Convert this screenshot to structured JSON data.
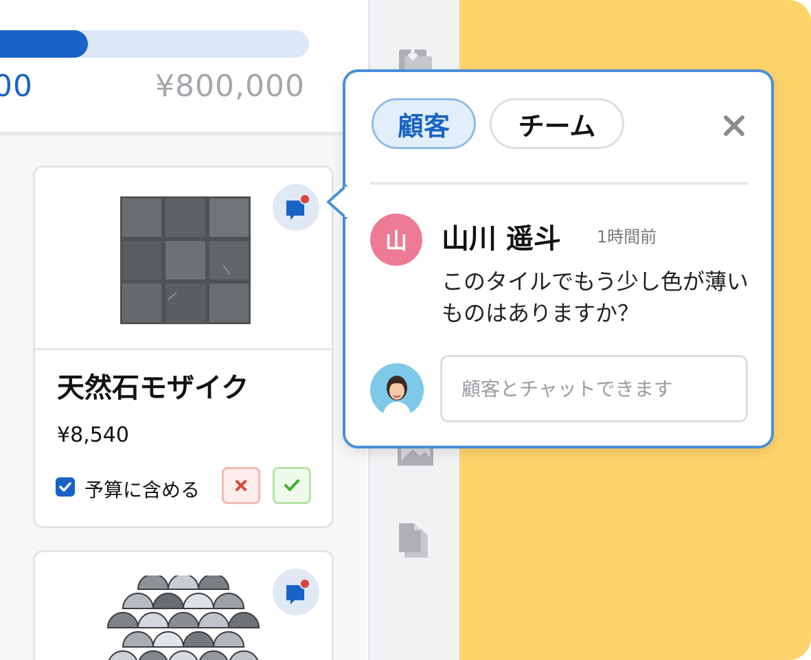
{
  "budget": {
    "current_amount_partial": "00",
    "total_amount": "¥800,000",
    "progress_fraction": 0.33
  },
  "products": [
    {
      "name": "天然石モザイク",
      "price": "¥8,540",
      "include_in_budget_label": "予算に含める",
      "include_in_budget_checked": true,
      "image": "gray-stone-square-mosaic"
    },
    {
      "image": "gray-fan-scale-mosaic"
    }
  ],
  "chat": {
    "tabs": [
      {
        "label": "顧客",
        "active": true
      },
      {
        "label": "チーム",
        "active": false
      }
    ],
    "message": {
      "author_initial": "山",
      "author": "山川 遥斗",
      "time": "1時間前",
      "text": "このタイルでもう少し色が薄いものはありますか？"
    },
    "input_placeholder": "顧客とチャットできます"
  },
  "icons": {
    "close": "close-icon",
    "comment": "comment-bubble-icon",
    "reject": "x-icon",
    "approve": "check-icon",
    "toolbar": [
      "download-icon",
      "image-icon",
      "documents-icon"
    ]
  },
  "colors": {
    "accent": "#1a63c6",
    "yellow_panel": "#ffd36b",
    "avatar_pink": "#ee7b96",
    "notification_dot": "#d9453b"
  }
}
